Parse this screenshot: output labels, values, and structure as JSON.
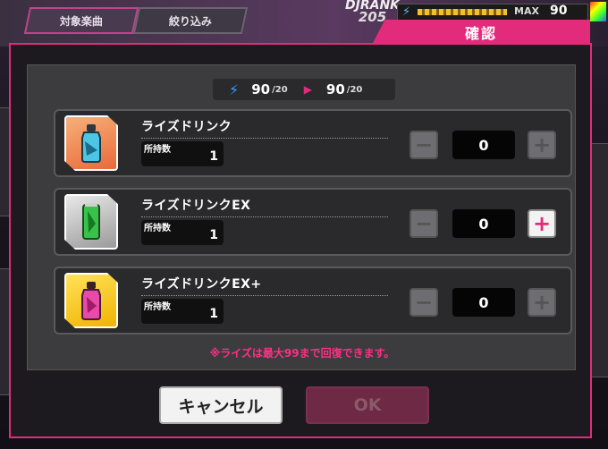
{
  "background": {
    "tabs": [
      "対象楽曲",
      "絞り込み"
    ],
    "rank_label": "DJRANK",
    "rank_value": "205",
    "stamina_label": "MAX",
    "stamina_value": "90"
  },
  "dialog": {
    "title": "確認",
    "stamina": {
      "current": "90",
      "current_max": "/20",
      "next": "90",
      "next_max": "/20"
    },
    "owned_label": "所持数",
    "items": [
      {
        "name": "ライズドリンク",
        "owned": "1",
        "quantity": "0",
        "icon_color": "#e86a3a",
        "icon": "bottle-icon"
      },
      {
        "name": "ライズドリンクEX",
        "owned": "1",
        "quantity": "0",
        "icon_color": "#9a9a9a",
        "icon": "can-icon"
      },
      {
        "name": "ライズドリンクEX+",
        "owned": "1",
        "quantity": "0",
        "icon_color": "#f0b400",
        "icon": "bottle-icon"
      }
    ],
    "note": "※ライズは最大99まで回復できます。",
    "cancel_label": "キャンセル",
    "ok_label": "OK"
  },
  "colors": {
    "accent": "#e32b7c",
    "bolt": "#3a9bff"
  }
}
